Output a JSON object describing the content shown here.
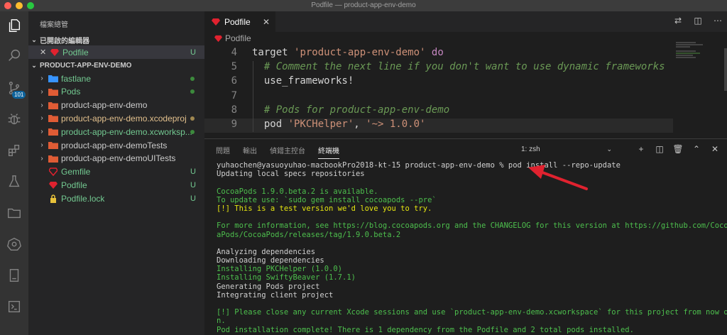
{
  "window": {
    "title": "Podfile — product-app-env-demo"
  },
  "colors": {
    "accent": "#0e639c",
    "green": "#73c991",
    "orange": "#e2c08d",
    "red_arrow": "#e0222f"
  },
  "activity": [
    {
      "name": "files-icon"
    },
    {
      "name": "search-icon"
    },
    {
      "name": "source-control-icon",
      "badge": "101"
    },
    {
      "name": "debug-icon"
    },
    {
      "name": "extensions-icon"
    },
    {
      "name": "flask-icon"
    },
    {
      "name": "folder-icon"
    },
    {
      "name": "kubernetes-icon"
    },
    {
      "name": "book-icon"
    },
    {
      "name": "terminal-icon"
    }
  ],
  "sidebar": {
    "title": "檔案總管",
    "open_editors": "已開啟的編輯器",
    "open_file": {
      "name": "Podfile",
      "status": "U"
    },
    "project": "PRODUCT-APP-ENV-DEMO",
    "items": [
      {
        "label": "fastlane",
        "type": "folder",
        "color": "#73c991",
        "status": "dot",
        "icon_color": "#3794ff"
      },
      {
        "label": "Pods",
        "type": "folder",
        "color": "#73c991",
        "status": "dot",
        "icon_color": "#e05c35"
      },
      {
        "label": "product-app-env-demo",
        "type": "folder",
        "color": "#cccccc",
        "status": "",
        "icon_color": "#e05c35"
      },
      {
        "label": "product-app-env-demo.xcodeproj",
        "type": "folder",
        "color": "#e2c08d",
        "status": "dot-orange",
        "icon_color": "#e05c35"
      },
      {
        "label": "product-app-env-demo.xcworksp...",
        "type": "folder",
        "color": "#73c991",
        "status": "dot",
        "icon_color": "#e05c35"
      },
      {
        "label": "product-app-env-demoTests",
        "type": "folder",
        "color": "#cccccc",
        "status": "",
        "icon_color": "#e05c35"
      },
      {
        "label": "product-app-env-demoUITests",
        "type": "folder",
        "color": "#cccccc",
        "status": "",
        "icon_color": "#e05c35"
      },
      {
        "label": "Gemfile",
        "type": "gem",
        "color": "#73c991",
        "status": "U"
      },
      {
        "label": "Podfile",
        "type": "ruby",
        "color": "#73c991",
        "status": "U"
      },
      {
        "label": "Podfile.lock",
        "type": "lock",
        "color": "#73c991",
        "status": "U"
      }
    ]
  },
  "editor": {
    "tab": "Podfile",
    "breadcrumb": "Podfile",
    "lines": [
      {
        "num": "4",
        "parts": [
          [
            "",
            "target "
          ],
          [
            "str",
            "'product-app-env-demo'"
          ],
          [
            "",
            " "
          ],
          [
            "kw",
            "do"
          ]
        ]
      },
      {
        "num": "5",
        "parts": [
          [
            "cm",
            "  # Comment the next line if you don't want to use dynamic frameworks"
          ]
        ]
      },
      {
        "num": "6",
        "parts": [
          [
            "",
            "  use_frameworks!"
          ]
        ]
      },
      {
        "num": "7",
        "parts": [
          [
            "",
            ""
          ]
        ]
      },
      {
        "num": "8",
        "parts": [
          [
            "cm",
            "  # Pods for product-app-env-demo"
          ]
        ]
      },
      {
        "num": "9",
        "parts": [
          [
            "",
            "  pod "
          ],
          [
            "str",
            "'PKCHelper'"
          ],
          [
            "",
            ", "
          ],
          [
            "str",
            "'~> 1.0.0'"
          ]
        ]
      }
    ]
  },
  "panel": {
    "tabs": [
      "問題",
      "輸出",
      "偵錯主控台",
      "終端機"
    ],
    "active_tab": 3,
    "terminal_select": "1: zsh",
    "lines": [
      {
        "c": "",
        "t": "yuhaochen@yasuoyuhao-macbookPro2018-kt-15 product-app-env-demo % pod install --repo-update"
      },
      {
        "c": "",
        "t": "Updating local specs repositories"
      },
      {
        "c": "",
        "t": ""
      },
      {
        "c": "g",
        "t": "CocoaPods 1.9.0.beta.2 is available."
      },
      {
        "c": "g",
        "t": "To update use: `sudo gem install cocoapods --pre`"
      },
      {
        "c": "y",
        "t": "[!] This is a test version we'd love you to try."
      },
      {
        "c": "",
        "t": ""
      },
      {
        "c": "g",
        "t": "For more information, see https://blog.cocoapods.org and the CHANGELOG for this version at https://github.com/Coco"
      },
      {
        "c": "g",
        "t": "aPods/CocoaPods/releases/tag/1.9.0.beta.2"
      },
      {
        "c": "",
        "t": ""
      },
      {
        "c": "",
        "t": "Analyzing dependencies"
      },
      {
        "c": "",
        "t": "Downloading dependencies"
      },
      {
        "c": "g",
        "t": "Installing PKCHelper (1.0.0)"
      },
      {
        "c": "g",
        "t": "Installing SwiftyBeaver (1.7.1)"
      },
      {
        "c": "",
        "t": "Generating Pods project"
      },
      {
        "c": "",
        "t": "Integrating client project"
      },
      {
        "c": "",
        "t": ""
      },
      {
        "c": "g",
        "t": "[!] Please close any current Xcode sessions and use `product-app-env-demo.xcworkspace` for this project from now o"
      },
      {
        "c": "g",
        "t": "n."
      },
      {
        "c": "g",
        "t": "Pod installation complete! There is 1 dependency from the Podfile and 2 total pods installed."
      }
    ]
  }
}
